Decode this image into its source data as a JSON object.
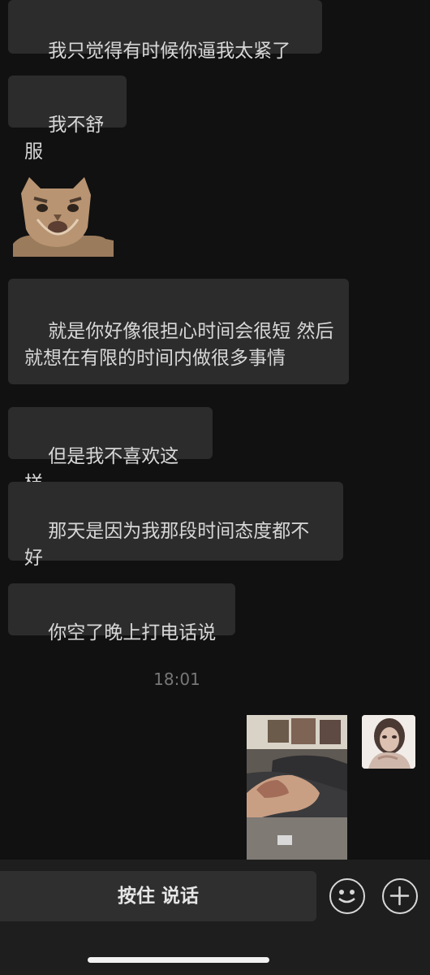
{
  "messages": [
    {
      "text": "我只觉得有时候你逼我太紧了"
    },
    {
      "text": "我不舒服"
    },
    {
      "text": "就是你好像很担心时间会很短 然后就想在有限的时间内做很多事情"
    },
    {
      "text": "但是我不喜欢这样"
    },
    {
      "text": "那天是因为我那段时间态度都不好"
    },
    {
      "text": "你空了晚上打电话说"
    }
  ],
  "timestamp": "18:01",
  "input": {
    "hold_to_talk_label": "按住 说话"
  },
  "icons": {
    "emoji": "emoji-icon",
    "plus": "plus-icon"
  },
  "colors": {
    "background": "#111111",
    "bubble": "#2c2c2c",
    "text": "#d7d7d7",
    "input_bar": "#1e1e1e"
  }
}
